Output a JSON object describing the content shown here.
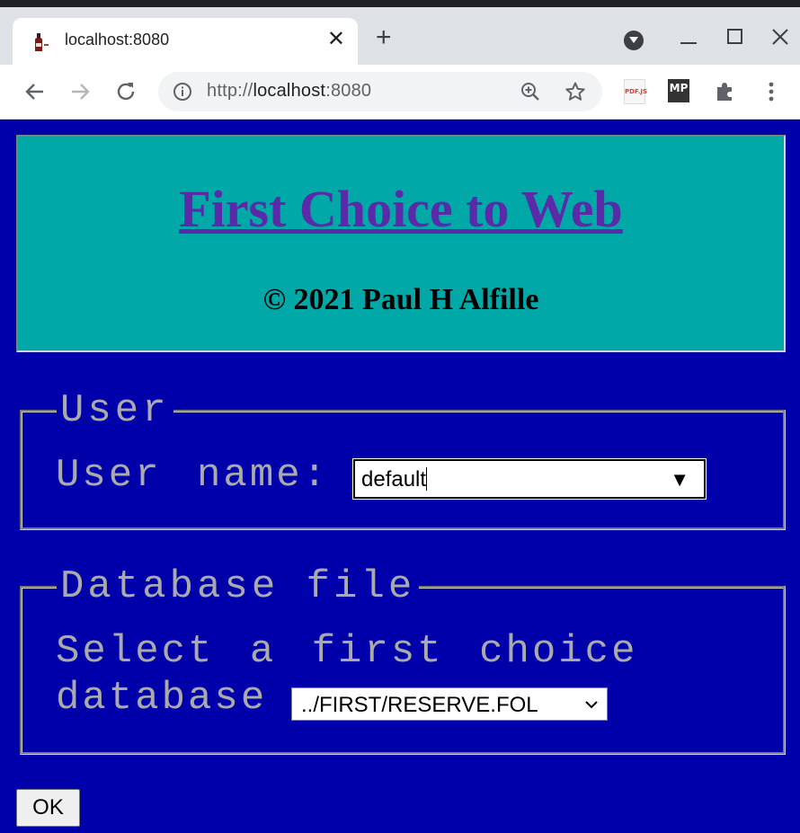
{
  "browser": {
    "tab_title": "localhost:8080",
    "close_tab_glyph": "✕",
    "new_tab_glyph": "+",
    "url_scheme": "http://",
    "url_host": "localhost",
    "url_port": ":8080",
    "extensions": [
      {
        "name": "pdfjs-extension-icon",
        "label": "PDF.JS"
      },
      {
        "name": "mp-extension-icon",
        "label": "MP"
      }
    ]
  },
  "page": {
    "title": "First Choice to Web",
    "copyright": "© 2021 Paul H Alfille",
    "user_section": {
      "legend": "User",
      "label": "User name:",
      "value": "default",
      "dropdown_glyph": "▼"
    },
    "database_section": {
      "legend": "Database file",
      "label_line1": "Select a first choice",
      "label_line2": "database",
      "selected": "../FIRST/RESERVE.FOL"
    },
    "ok_label": "OK"
  },
  "colors": {
    "page_background": "#0000aa",
    "header_background": "#00a8a8",
    "title_link": "#5a2aa8",
    "label_text": "#aaaaaa"
  }
}
